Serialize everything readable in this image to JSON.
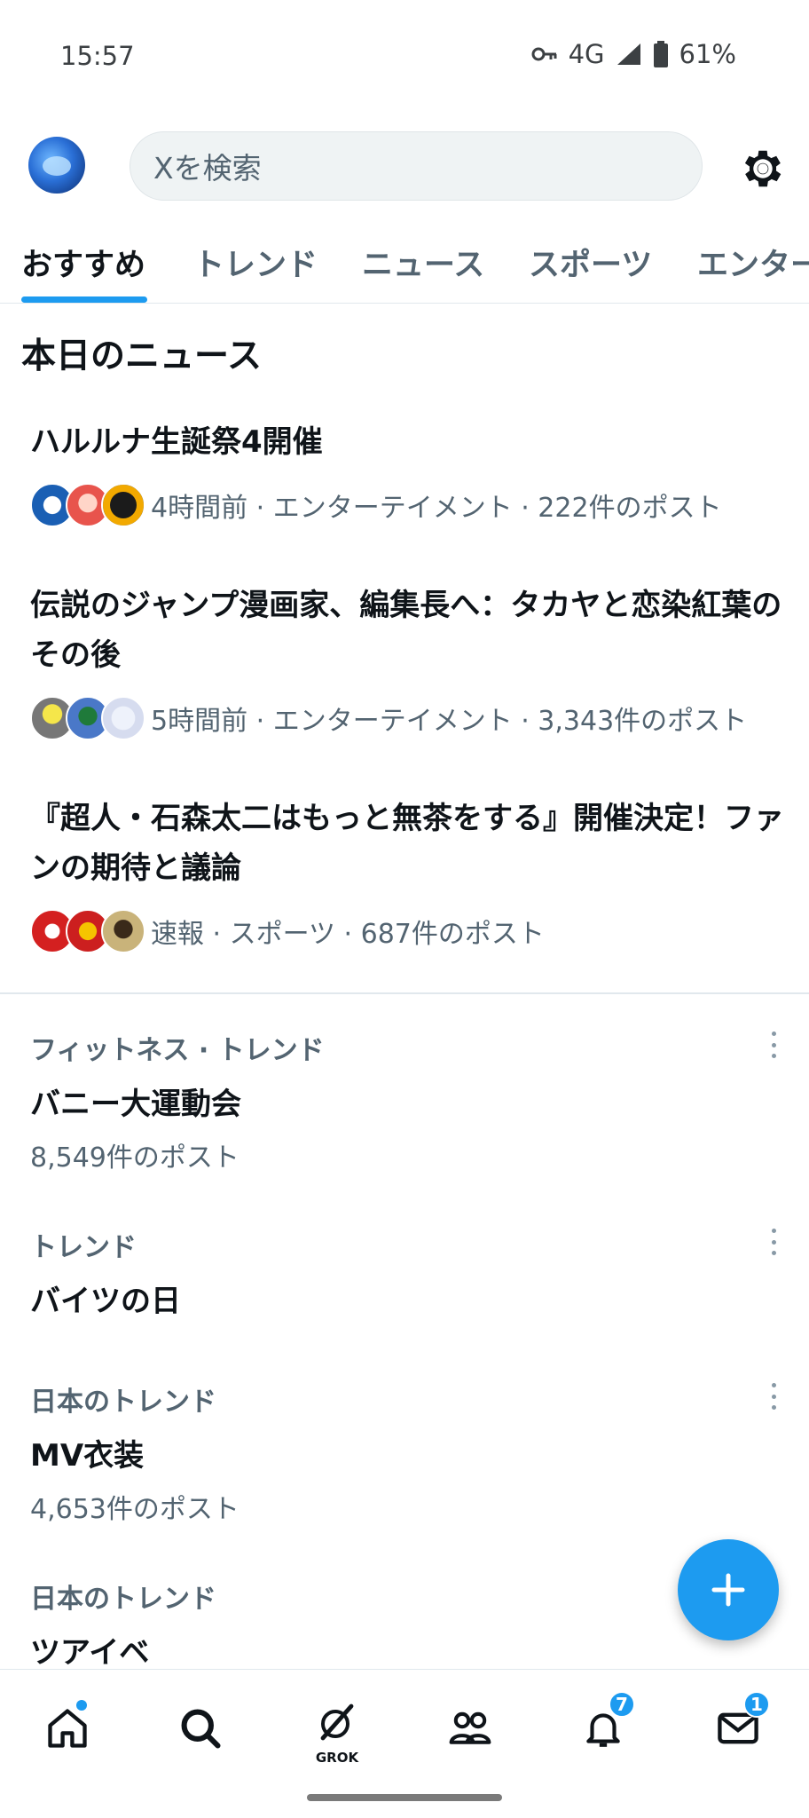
{
  "status_bar": {
    "time": "15:57",
    "network": "4G",
    "battery": "61%"
  },
  "header": {
    "search_placeholder": "Xを検索",
    "avatar_icon": "profile-avatar",
    "settings_icon": "gear-icon"
  },
  "tabs": [
    {
      "label": "おすすめ",
      "active": true
    },
    {
      "label": "トレンド"
    },
    {
      "label": "ニュース"
    },
    {
      "label": "スポーツ"
    },
    {
      "label": "エンター"
    }
  ],
  "news": {
    "title": "本日のニュース",
    "items": [
      {
        "headline": "ハルルナ生誕祭4開催",
        "meta": "4時間前 · エンターテイメント · 222件のポスト"
      },
      {
        "headline": "伝説のジャンプ漫画家、編集長へ：タカヤと恋染紅葉のその後",
        "meta": "5時間前 · エンターテイメント · 3,343件のポスト"
      },
      {
        "headline": "『超人・石森太二はもっと無茶をする』開催決定！ファンの期待と議論",
        "meta": "速報 · スポーツ · 687件のポスト"
      }
    ]
  },
  "trends": [
    {
      "context": "フィットネス · トレンド",
      "name": "バニー大運動会",
      "count": "8,549件のポスト"
    },
    {
      "context": "トレンド",
      "name": "バイツの日",
      "count": ""
    },
    {
      "context": "日本のトレンド",
      "name": "MV衣装",
      "count": "4,653件のポスト"
    },
    {
      "context": "日本のトレンド",
      "name": "ツアイベ",
      "count": ""
    }
  ],
  "fab": {
    "icon": "plus-icon"
  },
  "bottom_nav": {
    "grok_label": "GROK",
    "notifications_badge": "7",
    "messages_badge": "1"
  },
  "colors": {
    "accent": "#1d9bf0",
    "text_primary": "#0f1419",
    "text_secondary": "#536471"
  }
}
